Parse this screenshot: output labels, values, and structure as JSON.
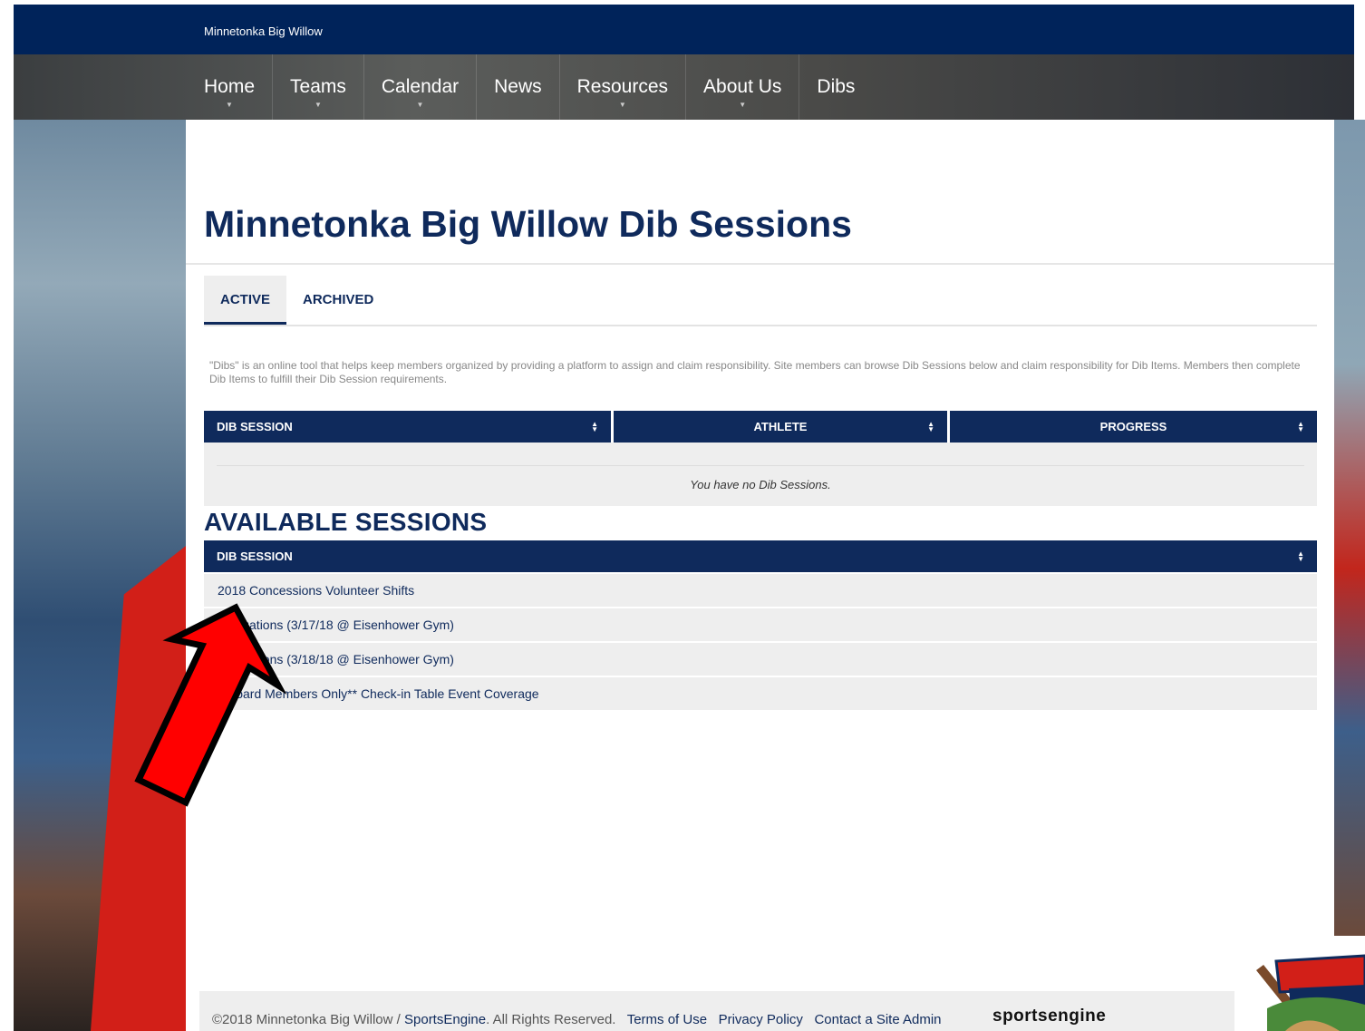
{
  "header": {
    "site_name": "Minnetonka Big Willow"
  },
  "nav": [
    {
      "label": "Home",
      "has_dropdown": true
    },
    {
      "label": "Teams",
      "has_dropdown": true
    },
    {
      "label": "Calendar",
      "has_dropdown": true
    },
    {
      "label": "News",
      "has_dropdown": false
    },
    {
      "label": "Resources",
      "has_dropdown": true
    },
    {
      "label": "About Us",
      "has_dropdown": true
    },
    {
      "label": "Dibs",
      "has_dropdown": false
    }
  ],
  "page": {
    "title": "Minnetonka Big Willow Dib Sessions",
    "tabs": {
      "active": "ACTIVE",
      "archived": "ARCHIVED"
    },
    "description": "\"Dibs\" is an online tool that helps keep members organized by providing a platform to assign and claim responsibility. Site members can browse Dib Sessions below and claim responsibility for Dib Items. Members then complete Dib Items to fulfill their Dib Session requirements."
  },
  "my_sessions_table": {
    "columns": [
      "DIB SESSION",
      "ATHLETE",
      "PROGRESS"
    ],
    "sort_icon": "sort-icon",
    "empty_message": "You have no Dib Sessions."
  },
  "available": {
    "heading": "AVAILABLE SESSIONS",
    "column": "DIB SESSION",
    "rows": [
      "2018 Concessions Volunteer Shifts",
      "Evaluations (3/17/18 @ Eisenhower Gym)",
      "Evaluations (3/18/18 @ Eisenhower Gym)",
      "**Board Members Only** Check-in Table Event Coverage"
    ]
  },
  "footer": {
    "copyright": "©2018 Minnetonka Big Willow / ",
    "sportsengine_link": "SportsEngine",
    "rights": ". All Rights Reserved.",
    "links": [
      "Terms of Use",
      "Privacy Policy",
      "Contact a Site Admin"
    ],
    "brand": "sportsengine"
  },
  "colors": {
    "navy": "#0f2a5c",
    "topbar": "#00235a",
    "annotation_arrow": "#ff0000"
  }
}
